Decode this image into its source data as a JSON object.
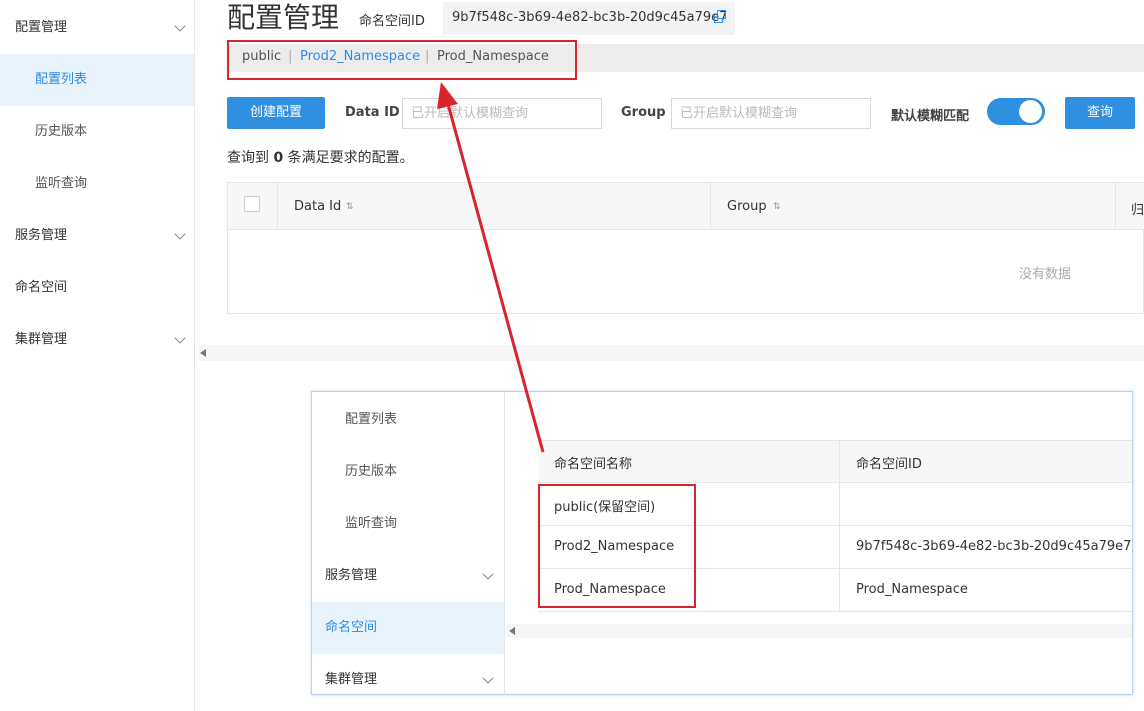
{
  "sidebar": {
    "items": [
      {
        "label": "配置管理",
        "type": "group"
      },
      {
        "label": "配置列表",
        "type": "sub",
        "active": true
      },
      {
        "label": "历史版本",
        "type": "sub"
      },
      {
        "label": "监听查询",
        "type": "sub"
      },
      {
        "label": "服务管理",
        "type": "group"
      },
      {
        "label": "命名空间",
        "type": "item"
      },
      {
        "label": "集群管理",
        "type": "group"
      }
    ]
  },
  "header": {
    "title": "配置管理",
    "namespace_id_label": "命名空间ID",
    "namespace_id_value": "9b7f548c-3b69-4e82-bc3b-20d9c45a79e7"
  },
  "namespace_tabs": {
    "items": [
      "public",
      "Prod2_Namespace",
      "Prod_Namespace"
    ],
    "separator": "|",
    "active": "Prod2_Namespace"
  },
  "search": {
    "create_button": "创建配置",
    "data_id_label": "Data ID",
    "data_id_placeholder": "已开启默认模糊查询",
    "group_label": "Group",
    "group_placeholder": "已开启默认模糊查询",
    "fuzzy_label": "默认模糊匹配",
    "fuzzy_on": true,
    "query_button": "查询"
  },
  "result": {
    "prefix": "查询到",
    "count": "0",
    "suffix": "条满足要求的配置。"
  },
  "config_table": {
    "columns": [
      "Data Id",
      "Group",
      "归"
    ],
    "empty_text": "没有数据"
  },
  "inset": {
    "sidebar_items": [
      {
        "label": "配置列表",
        "type": "sub"
      },
      {
        "label": "历史版本",
        "type": "sub"
      },
      {
        "label": "监听查询",
        "type": "sub"
      },
      {
        "label": "服务管理",
        "type": "group"
      },
      {
        "label": "命名空间",
        "type": "item",
        "active": true
      },
      {
        "label": "集群管理",
        "type": "group"
      }
    ],
    "table": {
      "columns": [
        "命名空间名称",
        "命名空间ID"
      ],
      "rows": [
        {
          "name": "public(保留空间)",
          "id": ""
        },
        {
          "name": "Prod2_Namespace",
          "id": "9b7f548c-3b69-4e82-bc3b-20d9c45a79e7"
        },
        {
          "name": "Prod_Namespace",
          "id": "Prod_Namespace"
        }
      ]
    }
  },
  "colors": {
    "accent": "#2f8fe0",
    "annotation_red": "#d9232d",
    "active_bg": "#e8f3fc"
  }
}
